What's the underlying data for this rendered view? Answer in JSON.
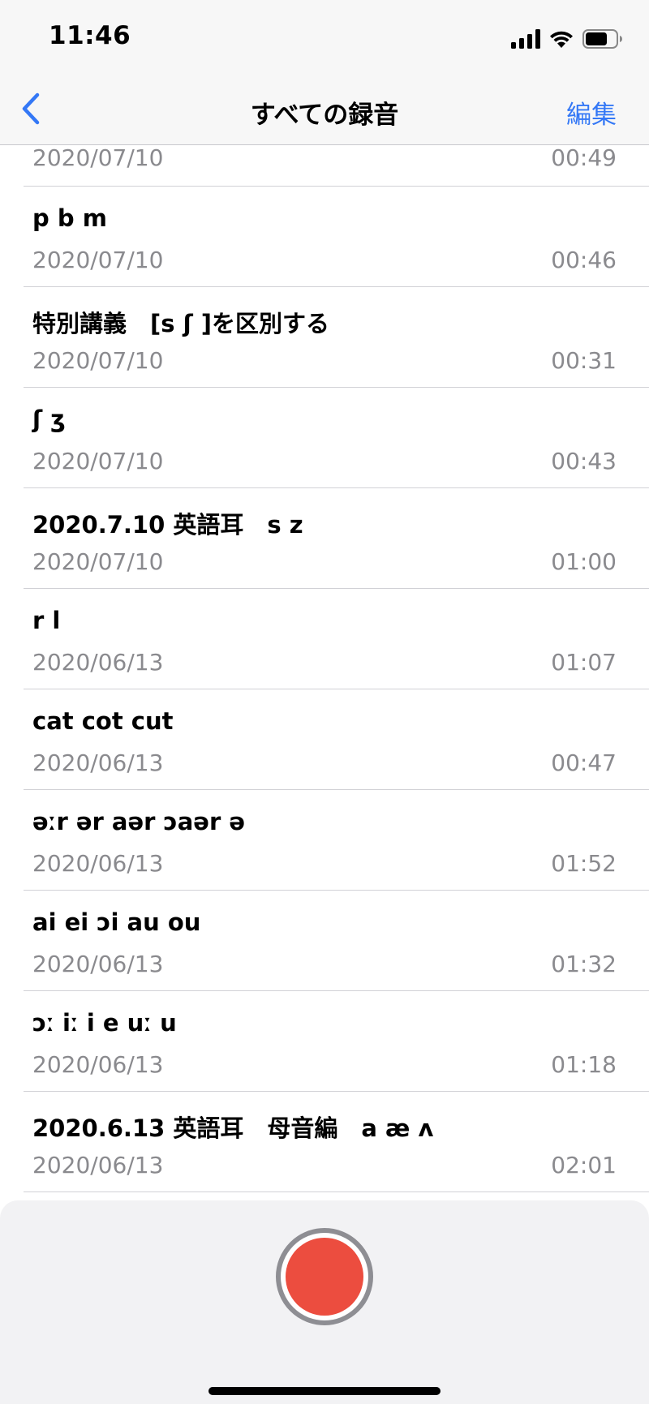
{
  "status_bar": {
    "time": "11:46",
    "icons": [
      "cellular-signal-icon",
      "wifi-icon",
      "battery-icon"
    ]
  },
  "nav": {
    "back_icon": "chevron-left-icon",
    "title": "すべての録音",
    "edit_label": "編集"
  },
  "partial_row": {
    "date": "2020/07/10",
    "duration": "00:49"
  },
  "recordings": [
    {
      "title": "p b m",
      "date": "2020/07/10",
      "duration": "00:46"
    },
    {
      "title": "特別講義　[s ʃ ]を区別する",
      "date": "2020/07/10",
      "duration": "00:31"
    },
    {
      "title": "ʃ ʒ",
      "date": "2020/07/10",
      "duration": "00:43"
    },
    {
      "title": "2020.7.10 英語耳　s z",
      "date": "2020/07/10",
      "duration": "01:00"
    },
    {
      "title": "r l",
      "date": "2020/06/13",
      "duration": "01:07"
    },
    {
      "title": "cat cot cut",
      "date": "2020/06/13",
      "duration": "00:47"
    },
    {
      "title": "əːr ər aər ɔaər ə",
      "date": "2020/06/13",
      "duration": "01:52"
    },
    {
      "title": "ai ei ɔi au ou",
      "date": "2020/06/13",
      "duration": "01:32"
    },
    {
      "title": "ɔː iː i e uː u",
      "date": "2020/06/13",
      "duration": "01:18"
    },
    {
      "title": "2020.6.13 英語耳　母音編　a æ ʌ",
      "date": "2020/06/13",
      "duration": "02:01"
    }
  ],
  "colors": {
    "accent": "#3478f6",
    "record": "#ec4d3f",
    "secondary_text": "#8a8a8e"
  }
}
